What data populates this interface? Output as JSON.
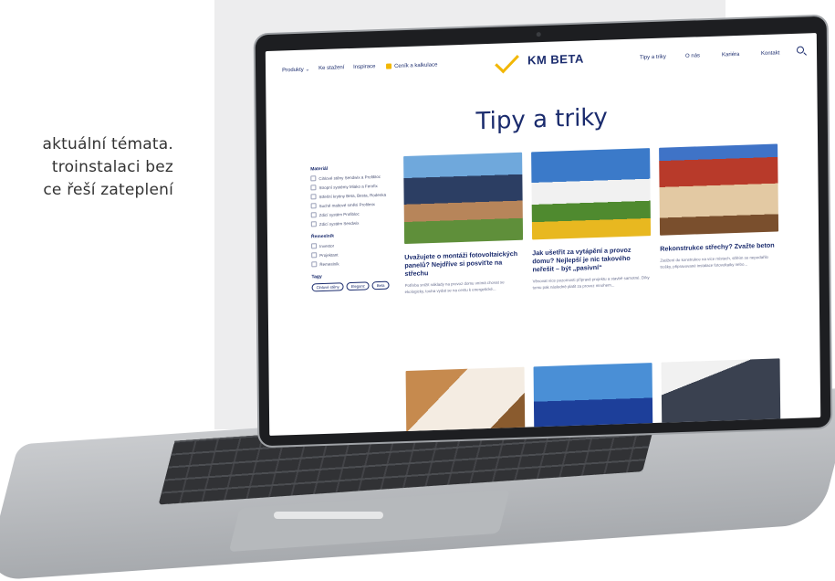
{
  "side_text": {
    "line1": "aktuální témata.",
    "line2": "troinstalaci  bez",
    "line3": "ce  řeší  zateplení"
  },
  "nav": {
    "items_left": [
      "Produkty ⌄",
      "Ke stažení",
      "Inspirace"
    ],
    "cenik_label": "Ceník a kalkulace",
    "logo_text": "KM BETA",
    "items_right": [
      "Tipy a triky",
      "O nás",
      "Kariéra",
      "Kontakt"
    ],
    "icons": {
      "search": "search-icon",
      "cenik": "calculator-icon"
    }
  },
  "page": {
    "title": "Tipy a triky"
  },
  "filters": {
    "material_heading": "Materiál",
    "material_items": [
      "Cihlové stěny Sendwix a Profibloc",
      "Stropní systémy Miako a Ferofix",
      "Střešní krytiny Beta, Besta, Rodenka",
      "Suché maltové směsi Profilmix",
      "Zdicí systém Profibloc",
      "Zdicí systém Sendwix"
    ],
    "owner_heading": "Řemeslník",
    "owner_items": [
      "Investor",
      "Projektant",
      "Řemeslník"
    ],
    "tags_heading": "Tagy",
    "tags": [
      "Cihlové stěny",
      "Eleganz",
      "Beta"
    ]
  },
  "articles": [
    {
      "title": "Uvažujete o montáži fotovoltaických panelů? Nejdříve si posviťte na střechu",
      "text": "Potřeba snížit náklady na provoz domu vnímá chovat se ekologicky, touha vydat se na cestu k energetické..."
    },
    {
      "title": "Jak ušetřit za vytápění a provoz domu? Nejlepší je nic takového neřešit – být „pasivní“",
      "text": "Věnovat více pozornosti přípravě projektu a stavbě samotné. Díky tomu pak následně platit za provoz mnohem..."
    },
    {
      "title": "Rekonstrukce střechy? Zvažte beton",
      "text": "Zatížení do konstrukce na více místech, střěím se nepodařilo trošky, připravované instalace fotovoltaiky nebo..."
    },
    {
      "title": "",
      "text": ""
    },
    {
      "title": "",
      "text": ""
    },
    {
      "title": "",
      "text": ""
    }
  ],
  "colors": {
    "brand_navy": "#1a2b6d",
    "accent_yellow": "#f2b705"
  }
}
